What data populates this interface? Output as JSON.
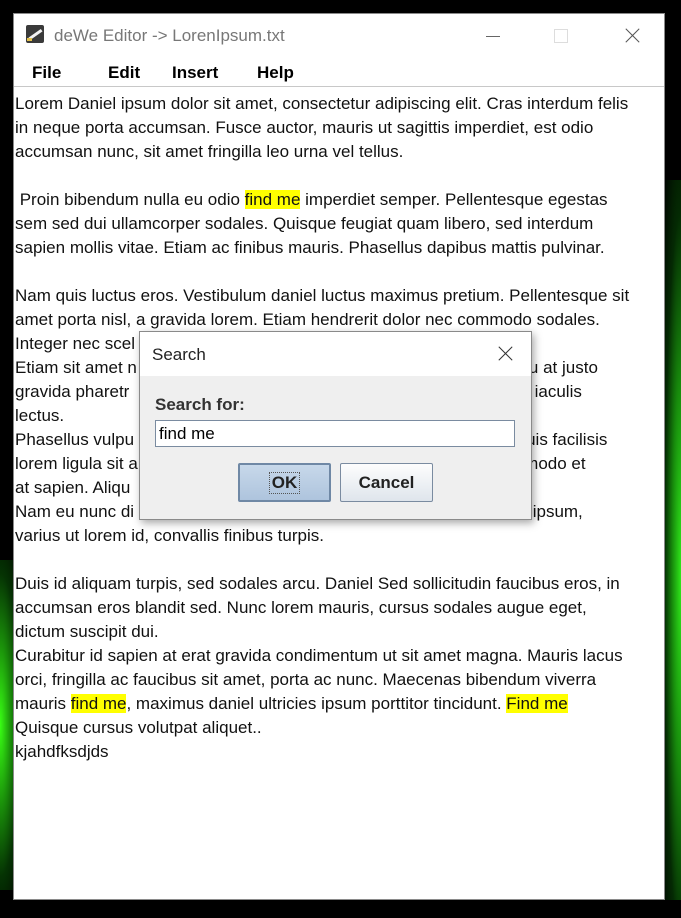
{
  "window": {
    "title": "deWe Editor -> LorenIpsum.txt"
  },
  "menu": {
    "file": "File",
    "edit": "Edit",
    "insert": "Insert",
    "help": "Help"
  },
  "document": {
    "lines": [
      [
        {
          "t": "Lorem Daniel ipsum dolor sit amet, consectetur adipiscing elit. Cras interdum felis"
        }
      ],
      [
        {
          "t": "in neque porta accumsan. Fusce auctor, mauris ut sagittis imperdiet, est odio"
        }
      ],
      [
        {
          "t": "accumsan nunc, sit amet fringilla leo urna vel tellus."
        }
      ],
      [
        {
          "t": ""
        }
      ],
      [
        {
          "t": " Proin bibendum nulla eu odio "
        },
        {
          "t": "find me",
          "hl": true
        },
        {
          "t": " imperdiet semper. Pellentesque egestas"
        }
      ],
      [
        {
          "t": "sem sed dui ullamcorper sodales. Quisque feugiat quam libero, sed interdum"
        }
      ],
      [
        {
          "t": "sapien mollis vitae. Etiam ac finibus mauris. Phasellus dapibus mattis pulvinar."
        }
      ],
      [
        {
          "t": ""
        }
      ],
      [
        {
          "t": "Nam quis luctus eros. Vestibulum daniel luctus maximus pretium. Pellentesque sit"
        }
      ],
      [
        {
          "t": "amet porta nisl, a gravida lorem. Etiam hendrerit dolor nec commodo sodales."
        }
      ],
      [
        {
          "t": "Integer nec scel                                                                          tor."
        }
      ],
      [
        {
          "t": "Etiam sit amet n                                                                         on arcu at justo"
        }
      ],
      [
        {
          "t": "gravida pharetr                                                                          que ac iaculis"
        }
      ],
      [
        {
          "t": "lectus."
        }
      ],
      [
        {
          "t": "Phasellus vulpu                                                                          ros, quis facilisis"
        }
      ],
      [
        {
          "t": "lorem ligula sit a                                                                        e commodo et"
        }
      ],
      [
        {
          "t": "at sapien. Aliqu"
        }
      ],
      [
        {
          "t": "Nam eu nunc di                                                                           tellus ipsum,"
        }
      ],
      [
        {
          "t": "varius ut lorem id, convallis finibus turpis."
        }
      ],
      [
        {
          "t": ""
        }
      ],
      [
        {
          "t": "Duis id aliquam turpis, sed sodales arcu. Daniel Sed sollicitudin faucibus eros, in"
        }
      ],
      [
        {
          "t": "accumsan eros blandit sed. Nunc lorem mauris, cursus sodales augue eget,"
        }
      ],
      [
        {
          "t": "dictum suscipit dui."
        }
      ],
      [
        {
          "t": "Curabitur id sapien at erat gravida condimentum ut sit amet magna. Mauris lacus"
        }
      ],
      [
        {
          "t": "orci, fringilla ac faucibus sit amet, porta ac nunc. Maecenas bibendum viverra"
        }
      ],
      [
        {
          "t": "mauris "
        },
        {
          "t": "find me",
          "hl": true
        },
        {
          "t": ", maximus daniel ultricies ipsum porttitor tincidunt. "
        },
        {
          "t": "Find me",
          "hl": true
        }
      ],
      [
        {
          "t": "Quisque cursus volutpat aliquet.."
        }
      ],
      [
        {
          "t": "kjahdfksdjds"
        }
      ]
    ],
    "highlight_color": "#ffff00"
  },
  "search_dialog": {
    "title": "Search",
    "label": "Search for:",
    "input_value": "find me",
    "ok_label": "OK",
    "cancel_label": "Cancel"
  }
}
